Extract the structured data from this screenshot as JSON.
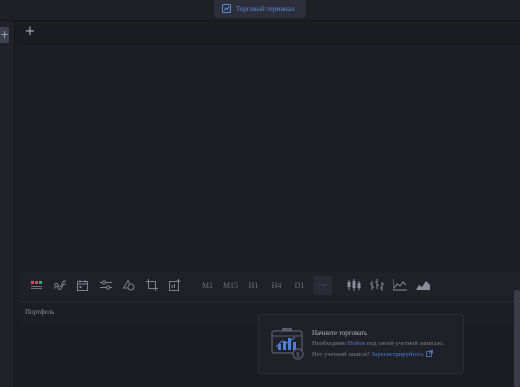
{
  "top_tab": {
    "label": "Торговый терминал",
    "icon": "chart-icon"
  },
  "left_strip": {
    "add_label": "+"
  },
  "tabs": {
    "add_label": "+"
  },
  "toolbar": {
    "tools": [
      {
        "name": "indicator-bars-icon"
      },
      {
        "name": "wave-icon"
      },
      {
        "name": "calendar-icon"
      },
      {
        "name": "sliders-icon"
      },
      {
        "name": "shapes-icon"
      },
      {
        "name": "crop-icon"
      },
      {
        "name": "add-chart-icon"
      }
    ],
    "timeframes": [
      "M1",
      "M15",
      "H1",
      "H4",
      "D1"
    ],
    "more_label": "···",
    "chart_types": [
      {
        "name": "candles-icon"
      },
      {
        "name": "bars-icon"
      },
      {
        "name": "line-icon"
      },
      {
        "name": "area-icon"
      }
    ]
  },
  "portfolio": {
    "title": "Портфель",
    "card": {
      "title": "Начните торговать",
      "line1_prefix": "Необходимо",
      "line1_link": "Войти",
      "line1_suffix": "под своей учетной записью.",
      "line2_prefix": "Нет учетной записи?",
      "line2_link": "Зарегистрируйтесь",
      "icon": "trading-monitor-icon",
      "external_icon": "external-link-icon"
    }
  },
  "colors": {
    "accent": "#4d7fd4",
    "background": "#1c1d23",
    "panel": "#1f2028"
  }
}
